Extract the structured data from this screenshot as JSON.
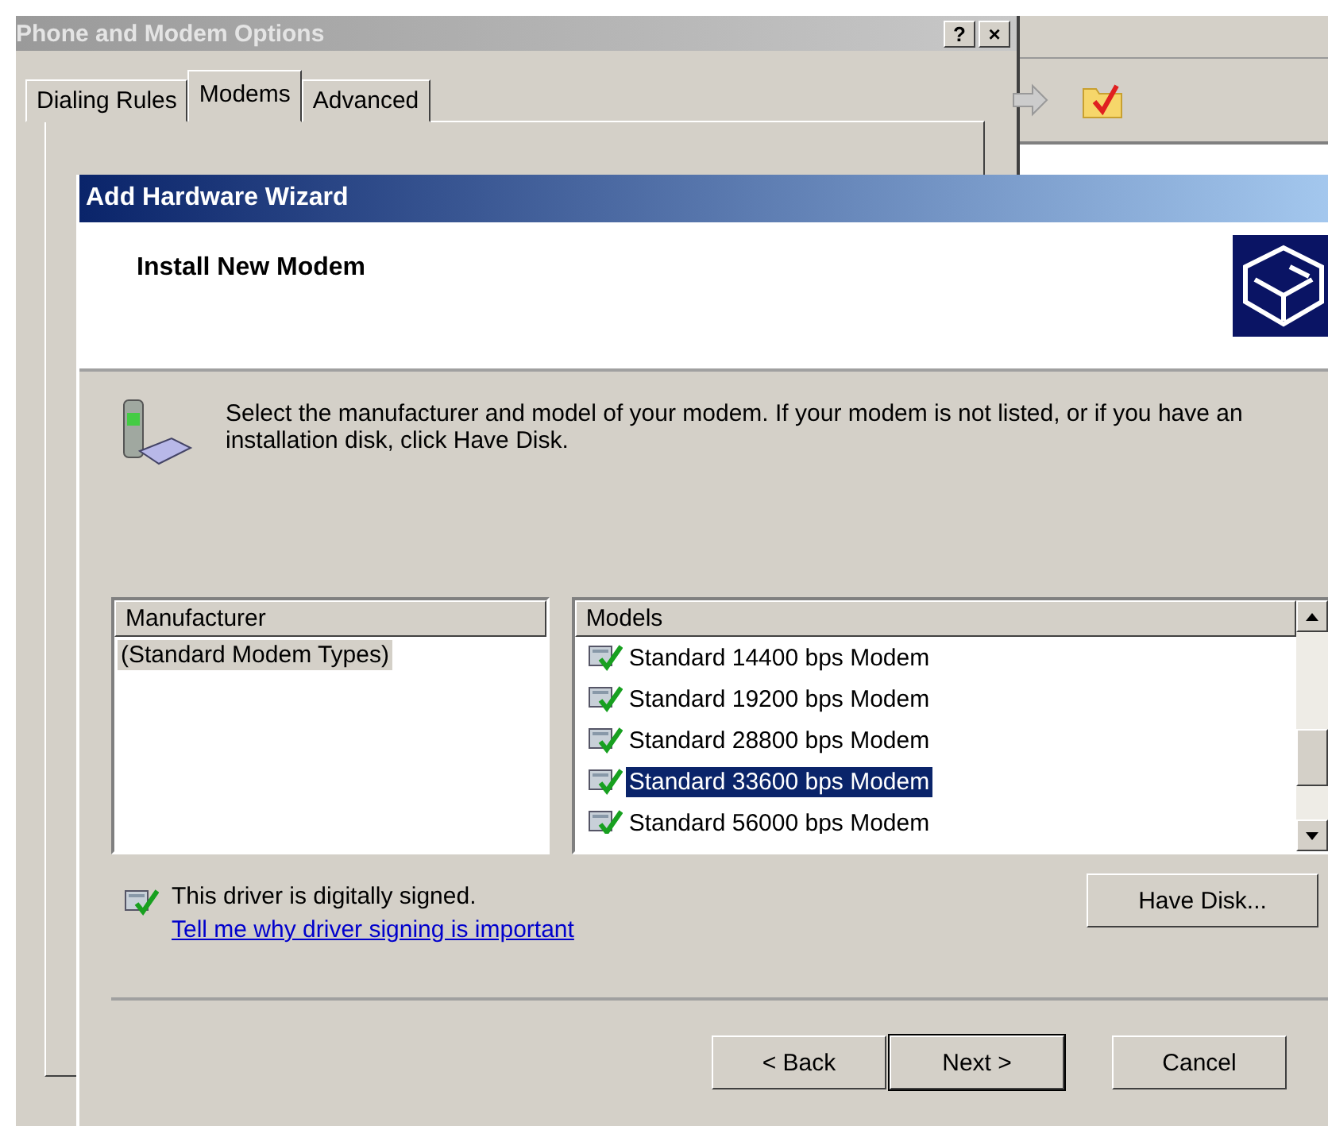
{
  "back_window": {
    "title": "Phone and Modem Options",
    "title_buttons": [
      "?",
      "×"
    ],
    "tabs": [
      {
        "label": "Dialing Rules",
        "selected": false
      },
      {
        "label": "Modems",
        "selected": true
      },
      {
        "label": "Advanced",
        "selected": false
      }
    ]
  },
  "wizard": {
    "title": "Add Hardware Wizard",
    "heading": "Install New Modem",
    "instruction": "Select the manufacturer and model of your modem. If your modem is not listed, or if you have an installation disk, click Have Disk.",
    "manufacturers": {
      "header": "Manufacturer",
      "items": [
        {
          "label": "(Standard Modem Types)",
          "selected": true
        }
      ]
    },
    "models": {
      "header": "Models",
      "items": [
        {
          "label": "Standard 14400 bps Modem",
          "selected": false
        },
        {
          "label": "Standard 19200 bps Modem",
          "selected": false
        },
        {
          "label": "Standard 28800 bps Modem",
          "selected": false
        },
        {
          "label": "Standard 33600 bps Modem",
          "selected": true
        },
        {
          "label": "Standard 56000 bps Modem",
          "selected": false
        }
      ]
    },
    "signed_text": "This driver is digitally signed.",
    "signing_link": "Tell me why driver signing is important",
    "have_disk": "Have Disk...",
    "buttons": [
      {
        "label": "< Back",
        "default": false
      },
      {
        "label": "Next >",
        "default": true
      },
      {
        "label": "Cancel",
        "default": false
      }
    ]
  }
}
